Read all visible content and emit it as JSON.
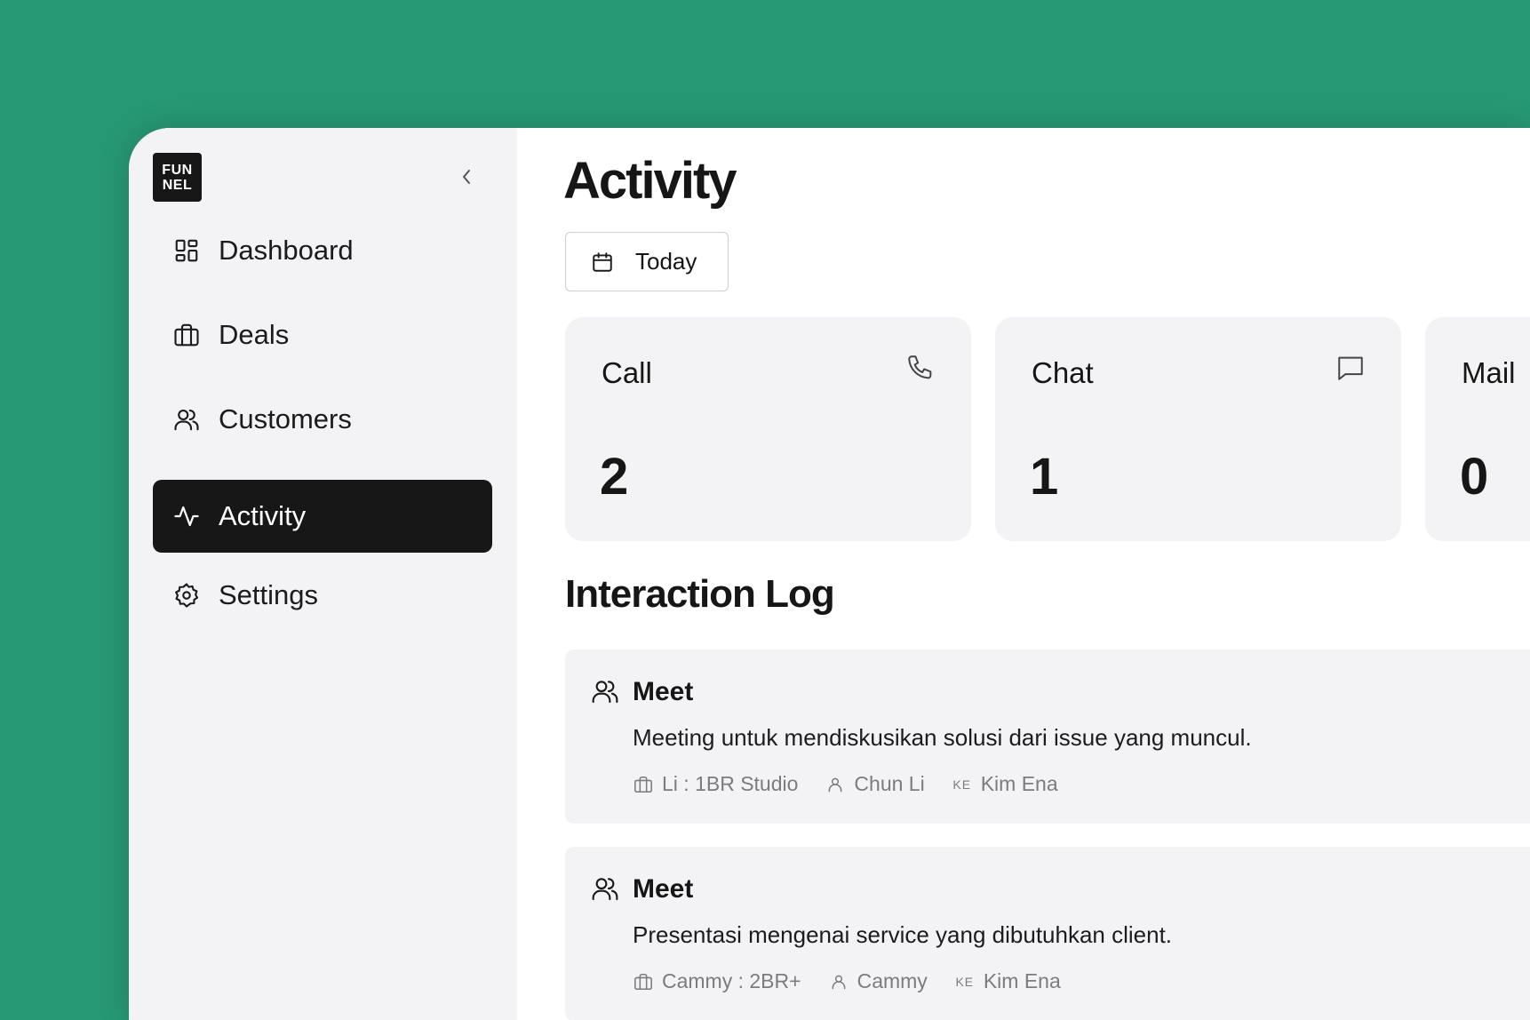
{
  "logo": {
    "line1": "FUN",
    "line2": "NEL"
  },
  "sidebar": {
    "items": [
      {
        "label": "Dashboard",
        "icon": "dashboard-icon"
      },
      {
        "label": "Deals",
        "icon": "briefcase-icon"
      },
      {
        "label": "Customers",
        "icon": "users-icon"
      },
      {
        "label": "Activity",
        "icon": "activity-icon",
        "active": true
      },
      {
        "label": "Settings",
        "icon": "gear-icon"
      }
    ]
  },
  "page": {
    "title": "Activity"
  },
  "date_filter": {
    "label": "Today",
    "icon": "calendar-icon"
  },
  "stats": [
    {
      "label": "Call",
      "value": "2",
      "icon": "phone-icon"
    },
    {
      "label": "Chat",
      "value": "1",
      "icon": "chat-icon"
    },
    {
      "label": "Mail",
      "value": "0",
      "icon": "mail-icon"
    }
  ],
  "interaction_log": {
    "title": "Interaction Log",
    "entries": [
      {
        "type": "Meet",
        "description": "Meeting untuk mendiskusikan solusi dari issue yang muncul.",
        "deal": "Li : 1BR Studio",
        "customer": "Chun Li",
        "owner_initials": "KE",
        "owner": "Kim Ena"
      },
      {
        "type": "Meet",
        "description": "Presentasi mengenai service yang dibutuhkan client.",
        "deal": "Cammy : 2BR+",
        "customer": "Cammy",
        "owner_initials": "KE",
        "owner": "Kim Ena"
      }
    ]
  },
  "colors": {
    "background": "#279874",
    "active_nav": "#171717",
    "card": "#f3f3f5"
  }
}
